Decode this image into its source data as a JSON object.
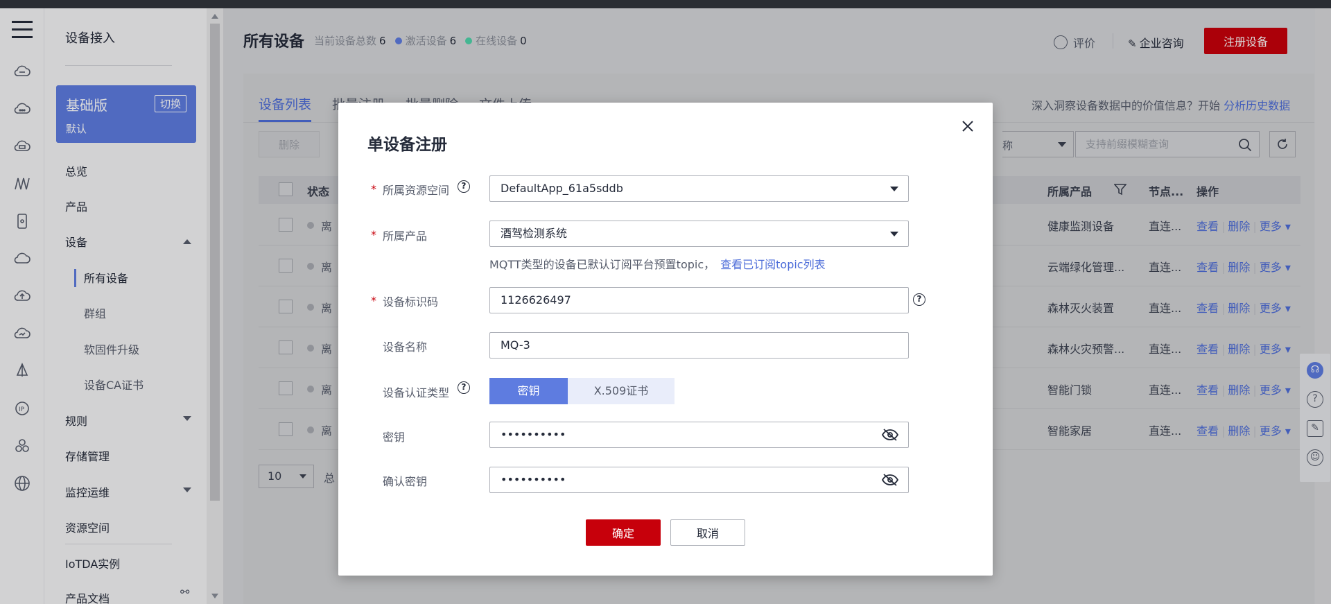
{
  "nav": {
    "title": "设备接入",
    "plan": {
      "name": "基础版",
      "switch": "切换",
      "default": "默认"
    },
    "items": {
      "overview": "总览",
      "product": "产品",
      "device": "设备",
      "all_devices": "所有设备",
      "group": "群组",
      "firmware": "软固件升级",
      "ca_cert": "设备CA证书",
      "rules": "规则",
      "storage": "存储管理",
      "monitor": "监控运维",
      "resource_space": "资源空间",
      "iotda": "IoTDA实例",
      "docs": "产品文档"
    }
  },
  "header": {
    "title": "所有设备",
    "total_label": "当前设备总数",
    "total": "6",
    "active_label": "激活设备",
    "active": "6",
    "online_label": "在线设备",
    "online": "0",
    "rate": "评价",
    "consult": "企业咨询",
    "register": "注册设备"
  },
  "colors": {
    "brand_red": "#c7000b",
    "accent_blue": "#5e7ce0",
    "active_dot": "#5e7ce0",
    "online_dot": "#50d4ab"
  },
  "tabs": [
    "设备列表",
    "批量注册",
    "批量删除",
    "文件上传"
  ],
  "insight": {
    "text": "深入洞察设备数据中的价值信息？开始",
    "link": "分析历史数据"
  },
  "toolbar": {
    "delete": "删除",
    "search_placeholder": "支持前缀模糊查询",
    "select_partial": "称"
  },
  "table": {
    "headers": {
      "status": "状态",
      "product": "所属产品",
      "node": "节点...",
      "ops": "操作"
    },
    "rows": [
      {
        "status": "离",
        "product": "健康监测设备",
        "node": "直连..."
      },
      {
        "status": "离",
        "product": "云端绿化管理...",
        "node": "直连..."
      },
      {
        "status": "离",
        "product": "森林灭火装置",
        "node": "直连..."
      },
      {
        "status": "离",
        "product": "森林火灾预警...",
        "node": "直连..."
      },
      {
        "status": "离",
        "product": "智能门锁",
        "node": "直连..."
      },
      {
        "status": "离",
        "product": "智能家居",
        "node": "直连..."
      }
    ],
    "op_view": "查看",
    "op_delete": "删除",
    "op_more": "更多",
    "page_size": "10",
    "pager_partial": "总"
  },
  "modal": {
    "title": "单设备注册",
    "resource_space_label": "所属资源空间",
    "resource_space_value": "DefaultApp_61a5sddb",
    "product_label": "所属产品",
    "product_value": "酒驾检测系统",
    "mqtt_hint": "MQTT类型的设备已默认订阅平台预置topic，",
    "mqtt_link": "查看已订阅topic列表",
    "identifier_label": "设备标识码",
    "identifier_value": "1126626497",
    "name_label": "设备名称",
    "name_value": "MQ-3",
    "auth_label": "设备认证类型",
    "auth_secret": "密钥",
    "auth_x509": "X.509证书",
    "secret_label": "密钥",
    "secret_value": "••••••••••",
    "confirm_label": "确认密钥",
    "confirm_value": "••••••••••",
    "ok": "确定",
    "cancel": "取消"
  }
}
